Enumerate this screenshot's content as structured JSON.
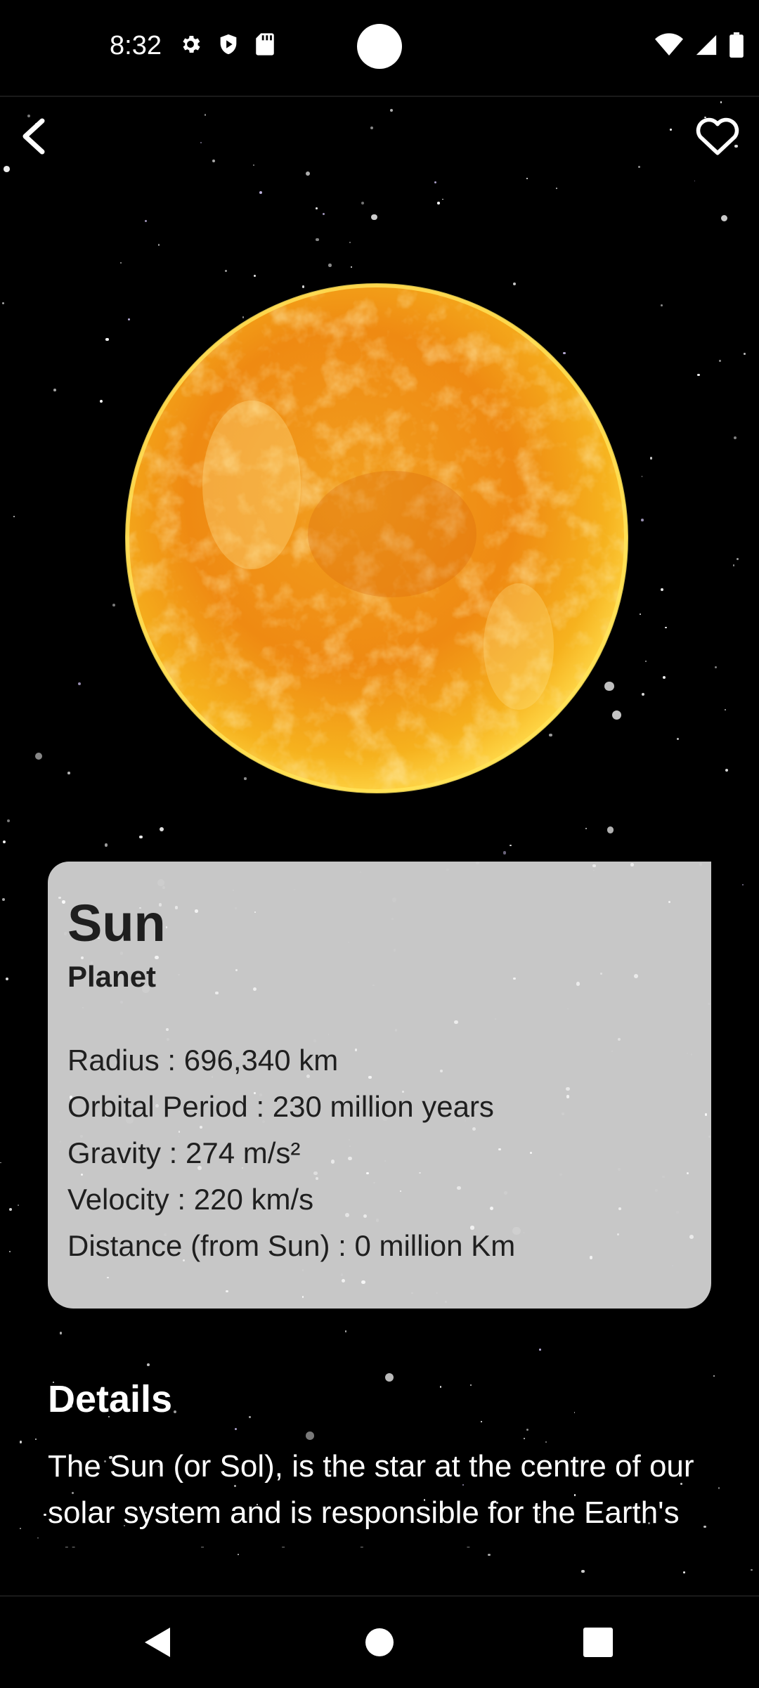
{
  "status_bar": {
    "time": "8:32",
    "left_icons": [
      "gear-icon",
      "play-shield-icon",
      "sd-card-icon"
    ],
    "right_icons": [
      "wifi-icon",
      "signal-icon",
      "battery-icon"
    ]
  },
  "top_bar": {
    "back_icon": "back-arrow-icon",
    "favorite_icon": "heart-outline-icon"
  },
  "body": {
    "name": "Sun",
    "type": "Planet",
    "facts": [
      "Radius : 696,340 km",
      "Orbital Period : 230 million years",
      "Gravity : 274 m/s²",
      "Velocity : 220 km/s",
      "Distance (from Sun) : 0 million Km"
    ]
  },
  "details": {
    "heading": "Details",
    "text": "The Sun (or Sol), is the star at the centre of our solar system and is responsible for the Earth's climate and weather. The Sun is"
  },
  "nav": {
    "back": "triangle-back-icon",
    "home": "circle-home-icon",
    "recents": "square-recents-icon"
  },
  "colors": {
    "background": "#000000",
    "card": "#cdcdcd",
    "sun_core": "#f39a12",
    "sun_highlight": "#ffe07a"
  }
}
